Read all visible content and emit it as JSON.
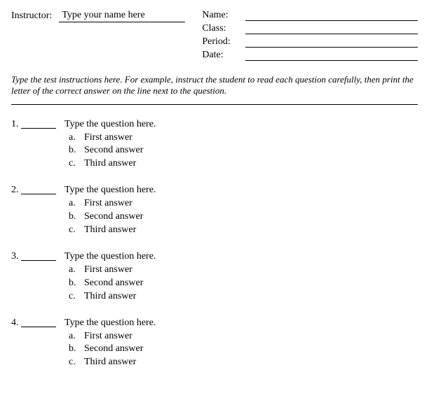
{
  "header": {
    "instructor_label": "Instructor:",
    "instructor_value": "Type your name here",
    "meta_labels": {
      "name": "Name:",
      "class": "Class:",
      "period": "Period:",
      "date": "Date:"
    }
  },
  "instructions": "Type the test instructions here.  For example, instruct the student to read each question carefully, then print the letter of the correct answer on the line next to the question.",
  "questions": [
    {
      "number": "1.",
      "text": "Type the question here.",
      "answers": [
        {
          "letter": "a.",
          "text": "First answer"
        },
        {
          "letter": "b.",
          "text": "Second answer"
        },
        {
          "letter": "c.",
          "text": "Third answer"
        }
      ]
    },
    {
      "number": "2.",
      "text": "Type the question here.",
      "answers": [
        {
          "letter": "a.",
          "text": "First answer"
        },
        {
          "letter": "b.",
          "text": "Second answer"
        },
        {
          "letter": "c.",
          "text": "Third answer"
        }
      ]
    },
    {
      "number": "3.",
      "text": "Type the question here.",
      "answers": [
        {
          "letter": "a.",
          "text": "First answer"
        },
        {
          "letter": "b.",
          "text": "Second answer"
        },
        {
          "letter": "c.",
          "text": "Third answer"
        }
      ]
    },
    {
      "number": "4.",
      "text": "Type the question here.",
      "answers": [
        {
          "letter": "a.",
          "text": "First answer"
        },
        {
          "letter": "b.",
          "text": "Second answer"
        },
        {
          "letter": "c.",
          "text": "Third answer"
        }
      ]
    }
  ]
}
